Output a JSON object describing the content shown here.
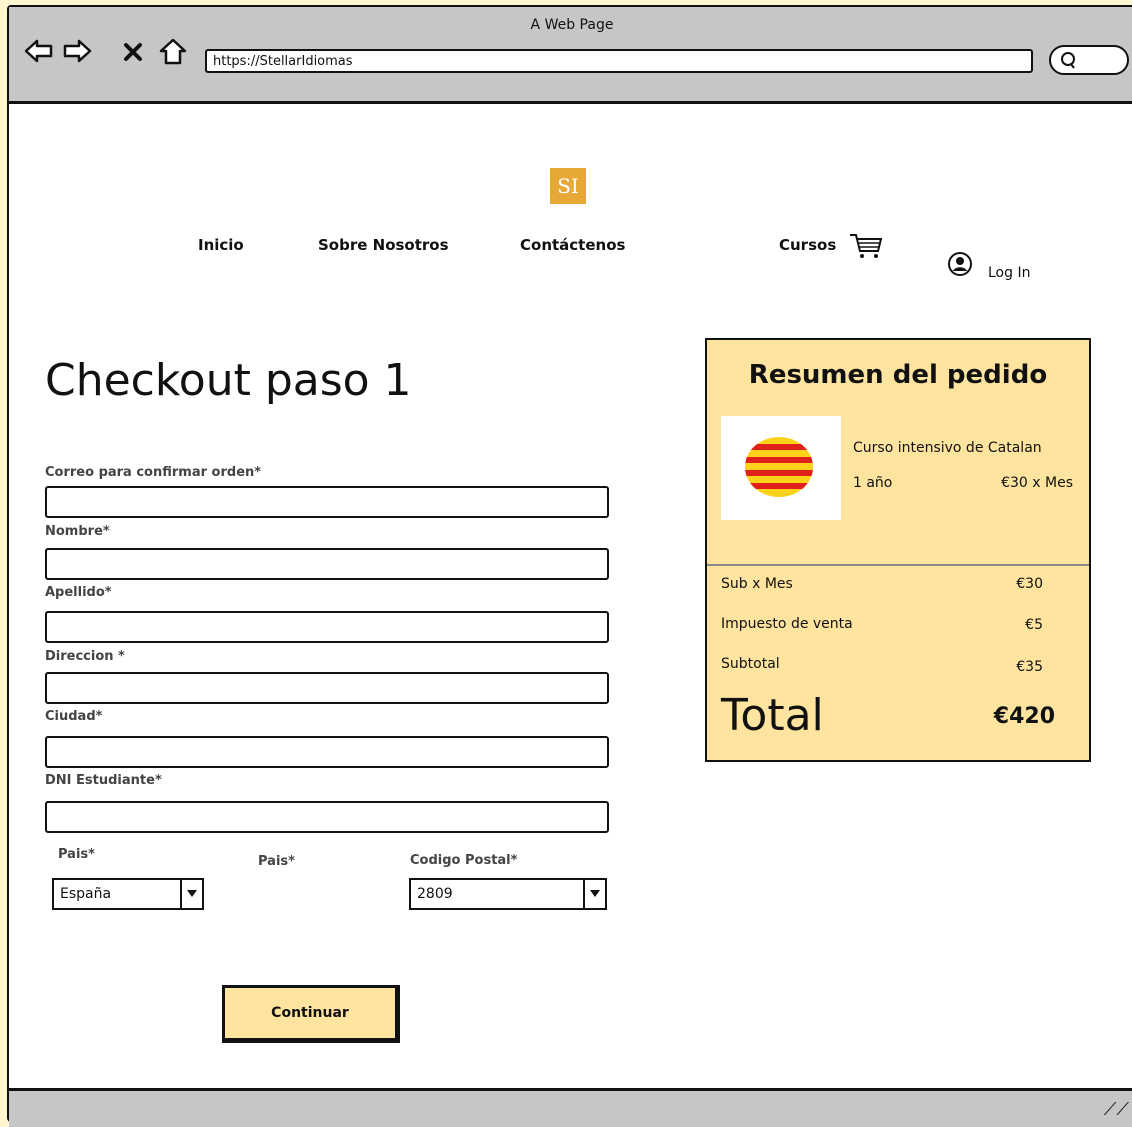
{
  "browser": {
    "window_title": "A Web Page",
    "url": "https://StellarIdiomas"
  },
  "site": {
    "logo_text": "SI",
    "logo_color": "#e8a838",
    "nav": [
      {
        "label": "Inicio"
      },
      {
        "label": "Sobre Nosotros"
      },
      {
        "label": "Contáctenos"
      },
      {
        "label": "Cursos"
      }
    ],
    "login_label": "Log In"
  },
  "checkout": {
    "title": "Checkout paso 1",
    "fields": [
      {
        "label": "Correo para confirmar orden*",
        "value": ""
      },
      {
        "label": "Nombre*",
        "value": ""
      },
      {
        "label": "Apellido*",
        "value": ""
      },
      {
        "label": "Direccion *",
        "value": ""
      },
      {
        "label": "Ciudad*",
        "value": ""
      },
      {
        "label": "DNI Estudiante*",
        "value": ""
      }
    ],
    "country_label": "Pais*",
    "country_value": "España",
    "region_label": "Pais*",
    "postal_label": "Codigo Postal*",
    "postal_value": "2809",
    "continue_label": "Continuar"
  },
  "summary": {
    "title": "Resumen del pedido",
    "background": "#ffe4a0",
    "course_name": "Curso intensivo de Catalan",
    "course_duration": "1 año",
    "course_price": "€30 x Mes",
    "rows": [
      {
        "label": "Sub x Mes",
        "value": "€30"
      },
      {
        "label": "Impuesto de venta",
        "value": "€5"
      },
      {
        "label": "Subtotal",
        "value": "€35"
      }
    ],
    "total_label": "Total",
    "total_value": "€420"
  }
}
